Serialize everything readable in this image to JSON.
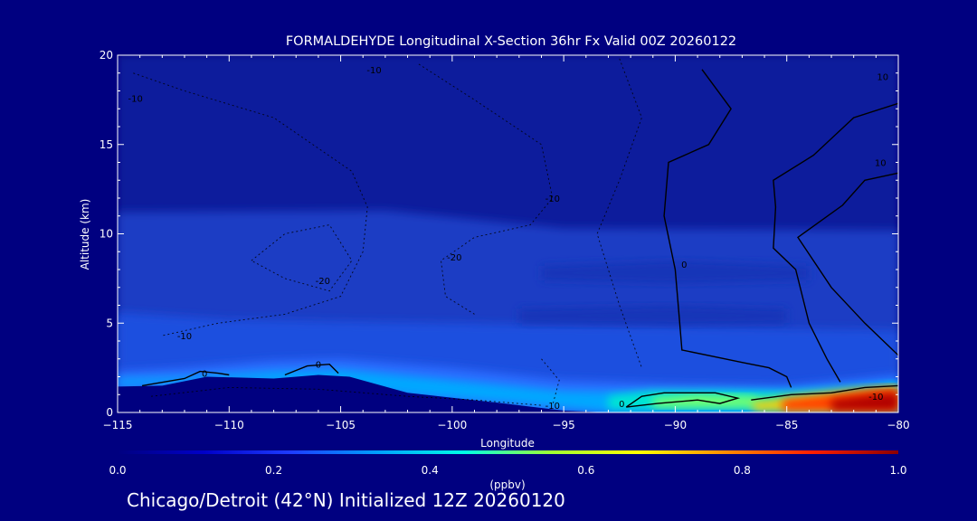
{
  "chart_data": {
    "type": "heatmap",
    "title": "FORMALDEHYDE Longitudinal X-Section 36hr  Fx Valid 00Z 20260122",
    "xlabel": "Longitude",
    "ylabel": "Altitude (km)",
    "x_ticks": [
      -115,
      -110,
      -105,
      -100,
      -95,
      -90,
      -85,
      -80
    ],
    "y_ticks": [
      0,
      5,
      10,
      15,
      20
    ],
    "xlim": [
      -115,
      -80
    ],
    "ylim": [
      0,
      20
    ],
    "colorbar": {
      "unit_label": "(ppbv)",
      "ticks": [
        0.0,
        0.2,
        0.4,
        0.6,
        0.8,
        1.0
      ],
      "tick_labels": [
        "0.0",
        "0.2",
        "0.4",
        "0.6",
        "0.8",
        "1.0"
      ],
      "colors": [
        "#000080",
        "#0000c8",
        "#1e3cff",
        "#00a0ff",
        "#00ffe6",
        "#a0ff32",
        "#ffff00",
        "#ff8c00",
        "#ff1e00",
        "#8b0000"
      ]
    },
    "contour_labels": [
      {
        "text": "-10",
        "lon": -114.2,
        "alt": 17.6
      },
      {
        "text": "-10",
        "lon": -103.5,
        "alt": 19.2
      },
      {
        "text": "10",
        "lon": -80.7,
        "alt": 18.8
      },
      {
        "text": "10",
        "lon": -80.8,
        "alt": 14.0
      },
      {
        "text": "-10",
        "lon": -95.5,
        "alt": 12.0
      },
      {
        "text": "-20",
        "lon": -99.9,
        "alt": 8.7
      },
      {
        "text": "-20",
        "lon": -105.8,
        "alt": 7.4
      },
      {
        "text": "-10",
        "lon": -112.0,
        "alt": 4.3
      },
      {
        "text": "0",
        "lon": -111.1,
        "alt": 2.2
      },
      {
        "text": "0",
        "lon": -106.0,
        "alt": 2.7
      },
      {
        "text": "0",
        "lon": -89.6,
        "alt": 8.3
      },
      {
        "text": "-10",
        "lon": -95.5,
        "alt": 0.4
      },
      {
        "text": "0",
        "lon": -92.4,
        "alt": 0.5
      },
      {
        "text": "-10",
        "lon": -81.0,
        "alt": 0.9
      }
    ]
  },
  "footer": "Chicago/Detroit (42°N) Initialized 12Z 20260120"
}
